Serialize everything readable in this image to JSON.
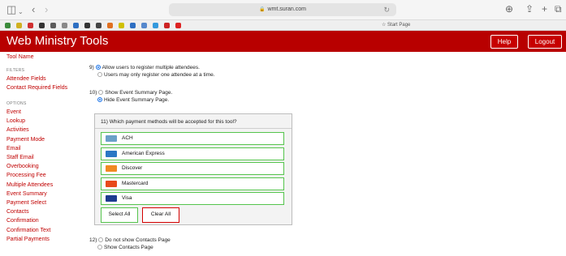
{
  "browser": {
    "url": "wmt.suran.com",
    "start_page": "Start Page",
    "colors": {
      "favicon": [
        "#3a8a3a",
        "#d0b020",
        "#d03030",
        "#333333",
        "#5a5a5a",
        "#888888",
        "#2d6fc2",
        "#333333",
        "#444444",
        "#e07020",
        "#d0c000",
        "#2d6fc2",
        "#5588cc",
        "#3399dd",
        "#cc2222",
        "#dd2222"
      ]
    }
  },
  "header": {
    "title": "Web Ministry Tools",
    "help_label": "Help",
    "logout_label": "Logout",
    "color": "#b80000"
  },
  "sidebar": {
    "tool_name": "Tool Name",
    "filters_heading": "FILTERS",
    "filters": [
      "Attendee Fields",
      "Contact Required Fields"
    ],
    "options_heading": "OPTIONS",
    "options": [
      "Event",
      "Lookup",
      "Activities",
      "Payment Mode",
      "Email",
      "Staff Email",
      "Overbooking",
      "Processing Fee",
      "Multiple Attendees",
      "Event Summary",
      "Payment Select",
      "Contacts",
      "Confirmation",
      "Confirmation Text",
      "Partial Payments"
    ]
  },
  "main": {
    "q9": {
      "number": "9)",
      "options": [
        {
          "label": "Allow users to register multiple attendees.",
          "selected": true
        },
        {
          "label": "Users may only register one attendee at a time.",
          "selected": false
        }
      ]
    },
    "q10": {
      "number": "10)",
      "options": [
        {
          "label": "Show Event Summary Page.",
          "selected": false
        },
        {
          "label": "Hide Event Summary Page.",
          "selected": true
        }
      ]
    },
    "q11": {
      "question": "11) Which payment methods will be accepted for this tool?",
      "methods": [
        {
          "label": "ACH",
          "icon": "ach-icon",
          "color": "#6aa0c8"
        },
        {
          "label": "American Express",
          "icon": "amex-card-icon",
          "color": "#2a77c4"
        },
        {
          "label": "Discover",
          "icon": "discover-card-icon",
          "color": "#f08a22"
        },
        {
          "label": "Mastercard",
          "icon": "mastercard-icon",
          "color": "#e84a1a"
        },
        {
          "label": "Visa",
          "icon": "visa-card-icon",
          "color": "#1d3c8f"
        }
      ],
      "select_all_label": "Select All",
      "clear_all_label": "Clear All",
      "accent_green": "#55c44d",
      "accent_red": "#d40000"
    },
    "q12": {
      "number": "12)",
      "options": [
        {
          "label": "Do not show Contacts Page",
          "selected": false
        },
        {
          "label": "Show Contacts Page",
          "selected": false
        }
      ]
    }
  }
}
